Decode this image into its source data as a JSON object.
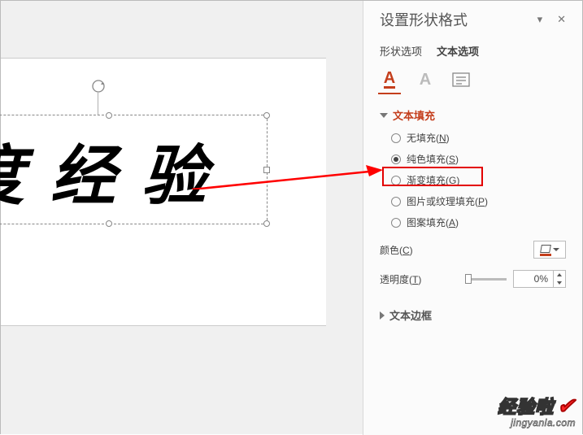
{
  "canvas": {
    "text": "度 经 验"
  },
  "panel": {
    "title": "设置形状格式",
    "tabs": {
      "shape_options": "形状选项",
      "text_options": "文本选项"
    },
    "icon_tabs": {
      "text_fill": "A",
      "text_outline": "A"
    },
    "section_text_fill": {
      "title": "文本填充",
      "radios": {
        "no_fill": "无填充(<u>N</u>)",
        "solid_fill": "纯色填充(<u>S</u>)",
        "gradient_fill": "渐变填充(<u>G</u>)",
        "picture_fill": "图片或纹理填充(<u>P</u>)",
        "pattern_fill": "图案填充(<u>A</u>)"
      },
      "color_label": "颜色(<u>C</u>)",
      "transparency_label": "透明度(<u>T</u>)",
      "transparency_value": "0%"
    },
    "section_text_outline": {
      "title": "文本边框"
    }
  },
  "watermark": {
    "main": "经验啦",
    "sub": "jingyanla.com"
  }
}
